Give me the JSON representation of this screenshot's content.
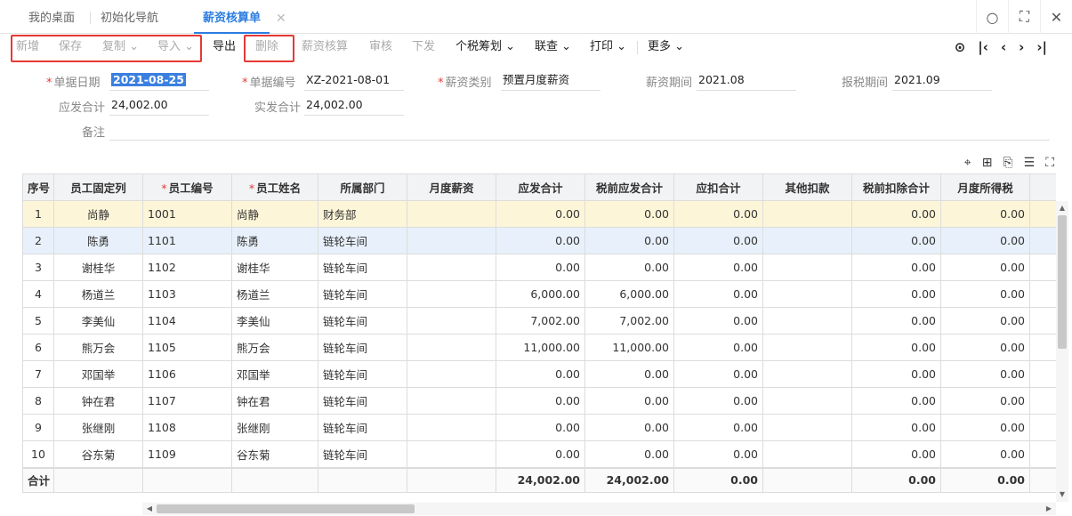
{
  "tabs": [
    {
      "label": "我的桌面"
    },
    {
      "label": "初始化导航"
    },
    {
      "label": "薪资核算单"
    }
  ],
  "window_icons": [
    "search-icon",
    "fullscreen-icon",
    "close-icon"
  ],
  "toolbar": {
    "new": "新增",
    "save": "保存",
    "copy": "复制",
    "import": "导入",
    "export": "导出",
    "delete": "删除",
    "salary_calc": "薪资核算",
    "audit": "审核",
    "issue": "下发",
    "tax_plan": "个税筹划",
    "link": "联查",
    "print": "打印",
    "more": "更多"
  },
  "form": {
    "doc_date_label": "单据日期",
    "doc_date": "2021-08-25",
    "doc_no_label": "单据编号",
    "doc_no": "XZ-2021-08-01",
    "salary_type_label": "薪资类别",
    "salary_type": "预置月度薪资",
    "salary_period_label": "薪资期间",
    "salary_period": "2021.08",
    "tax_period_label": "报税期间",
    "tax_period": "2021.09",
    "gross_total_label": "应发合计",
    "gross_total": "24,002.00",
    "net_total_label": "实发合计",
    "net_total": "24,002.00",
    "remark_label": "备注",
    "remark": ""
  },
  "table": {
    "headers": [
      "序号",
      "员工固定列",
      "员工编号",
      "员工姓名",
      "所属部门",
      "月度薪资",
      "应发合计",
      "税前应发合计",
      "应扣合计",
      "其他扣款",
      "税前扣除合计",
      "月度所得税"
    ],
    "rows": [
      {
        "no": "1",
        "fixed": "尚静",
        "code": "1001",
        "name": "尚静",
        "dept": "财务部",
        "monthly": "",
        "gross": "0.00",
        "pretax_gross": "0.00",
        "deduct": "0.00",
        "other": "",
        "pretax_deduct": "0.00",
        "tax": "0.00"
      },
      {
        "no": "2",
        "fixed": "陈勇",
        "code": "1101",
        "name": "陈勇",
        "dept": "链轮车间",
        "monthly": "",
        "gross": "0.00",
        "pretax_gross": "0.00",
        "deduct": "0.00",
        "other": "",
        "pretax_deduct": "0.00",
        "tax": "0.00"
      },
      {
        "no": "3",
        "fixed": "谢桂华",
        "code": "1102",
        "name": "谢桂华",
        "dept": "链轮车间",
        "monthly": "",
        "gross": "0.00",
        "pretax_gross": "0.00",
        "deduct": "0.00",
        "other": "",
        "pretax_deduct": "0.00",
        "tax": "0.00"
      },
      {
        "no": "4",
        "fixed": "杨道兰",
        "code": "1103",
        "name": "杨道兰",
        "dept": "链轮车间",
        "monthly": "",
        "gross": "6,000.00",
        "pretax_gross": "6,000.00",
        "deduct": "0.00",
        "other": "",
        "pretax_deduct": "0.00",
        "tax": "0.00"
      },
      {
        "no": "5",
        "fixed": "李美仙",
        "code": "1104",
        "name": "李美仙",
        "dept": "链轮车间",
        "monthly": "",
        "gross": "7,002.00",
        "pretax_gross": "7,002.00",
        "deduct": "0.00",
        "other": "",
        "pretax_deduct": "0.00",
        "tax": "0.00"
      },
      {
        "no": "6",
        "fixed": "熊万会",
        "code": "1105",
        "name": "熊万会",
        "dept": "链轮车间",
        "monthly": "",
        "gross": "11,000.00",
        "pretax_gross": "11,000.00",
        "deduct": "0.00",
        "other": "",
        "pretax_deduct": "0.00",
        "tax": "0.00"
      },
      {
        "no": "7",
        "fixed": "邓国举",
        "code": "1106",
        "name": "邓国举",
        "dept": "链轮车间",
        "monthly": "",
        "gross": "0.00",
        "pretax_gross": "0.00",
        "deduct": "0.00",
        "other": "",
        "pretax_deduct": "0.00",
        "tax": "0.00"
      },
      {
        "no": "8",
        "fixed": "钟在君",
        "code": "1107",
        "name": "钟在君",
        "dept": "链轮车间",
        "monthly": "",
        "gross": "0.00",
        "pretax_gross": "0.00",
        "deduct": "0.00",
        "other": "",
        "pretax_deduct": "0.00",
        "tax": "0.00"
      },
      {
        "no": "9",
        "fixed": "张继刚",
        "code": "1108",
        "name": "张继刚",
        "dept": "链轮车间",
        "monthly": "",
        "gross": "0.00",
        "pretax_gross": "0.00",
        "deduct": "0.00",
        "other": "",
        "pretax_deduct": "0.00",
        "tax": "0.00"
      },
      {
        "no": "10",
        "fixed": "谷东菊",
        "code": "1109",
        "name": "谷东菊",
        "dept": "链轮车间",
        "monthly": "",
        "gross": "0.00",
        "pretax_gross": "0.00",
        "deduct": "0.00",
        "other": "",
        "pretax_deduct": "0.00",
        "tax": "0.00"
      }
    ],
    "sum": {
      "label": "合计",
      "gross": "24,002.00",
      "pretax_gross": "24,002.00",
      "deduct": "0.00",
      "pretax_deduct": "0.00",
      "tax": "0.00"
    }
  },
  "colors": {
    "accent": "#2b7de0",
    "highlight_box": "#e53935",
    "selected_row": "#fdf5d8"
  }
}
